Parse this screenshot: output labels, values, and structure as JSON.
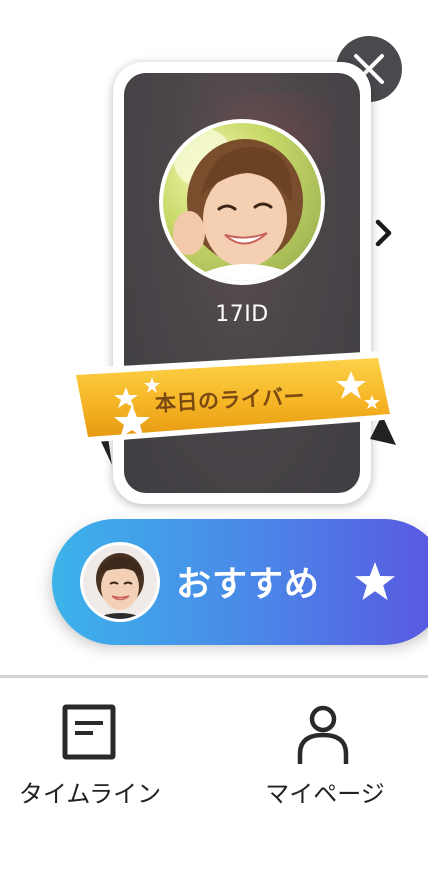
{
  "close_button": {
    "icon": "close-icon"
  },
  "featured_card": {
    "liver_id": "17ID",
    "next_icon": "chevron-right-icon"
  },
  "ribbon": {
    "label": "本日のライバー"
  },
  "recommended": {
    "label": "おすすめ",
    "icon": "star-icon"
  },
  "bottom_nav": {
    "items": [
      {
        "label": "タイムライン",
        "icon": "timeline-icon"
      },
      {
        "label": "マイページ",
        "icon": "person-icon"
      }
    ]
  },
  "colors": {
    "close_bg": "#4a4a4e",
    "card_bg": "#45404a",
    "ribbon_gold": "#f5b82a",
    "ribbon_text": "#7a4a12",
    "recommended_start": "#3cb3ea",
    "recommended_end": "#5a55e0",
    "nav_text": "#222222"
  }
}
